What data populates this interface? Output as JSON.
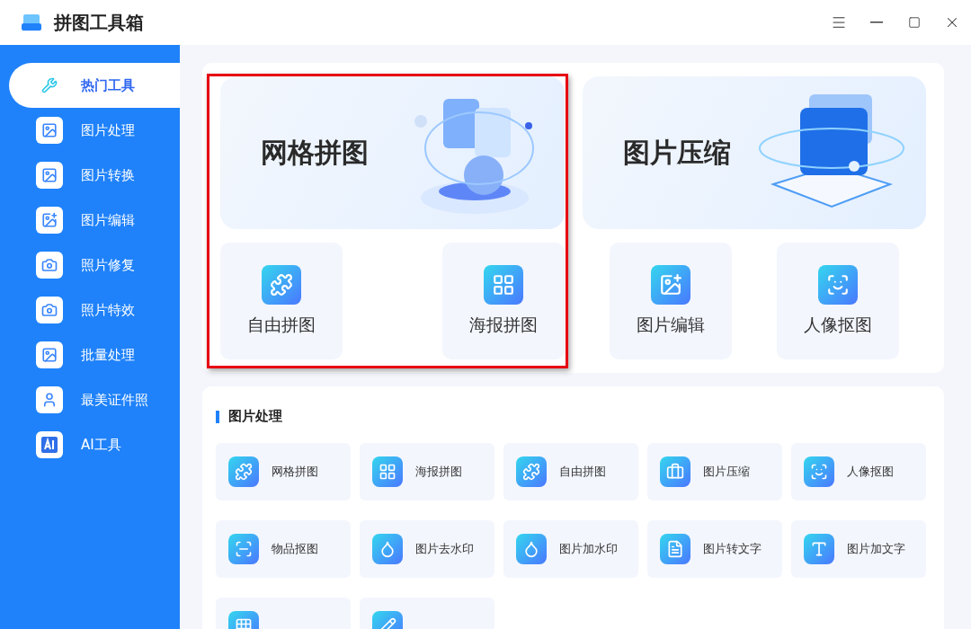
{
  "window": {
    "title": "拼图工具箱"
  },
  "sidebar": {
    "items": [
      {
        "label": "热门工具",
        "selected": true
      },
      {
        "label": "图片处理",
        "selected": false
      },
      {
        "label": "图片转换",
        "selected": false
      },
      {
        "label": "图片编辑",
        "selected": false
      },
      {
        "label": "照片修复",
        "selected": false
      },
      {
        "label": "照片特效",
        "selected": false
      },
      {
        "label": "批量处理",
        "selected": false
      },
      {
        "label": "最美证件照",
        "selected": false
      },
      {
        "label": "AI工具",
        "selected": false
      }
    ]
  },
  "featured": [
    {
      "title": "网格拼图",
      "highlighted": true,
      "tools": [
        "自由拼图",
        "海报拼图"
      ]
    },
    {
      "title": "图片压缩",
      "highlighted": false,
      "tools": [
        "图片编辑",
        "人像抠图"
      ]
    }
  ],
  "section": {
    "title": "图片处理",
    "tools": [
      {
        "kind": "labeled",
        "label": "网格拼图"
      },
      {
        "kind": "labeled",
        "label": "海报拼图"
      },
      {
        "kind": "labeled",
        "label": "自由拼图"
      },
      {
        "kind": "labeled",
        "label": "图片压缩"
      },
      {
        "kind": "labeled",
        "label": "人像抠图"
      },
      {
        "kind": "labeled",
        "label": "物品抠图"
      },
      {
        "kind": "labeled",
        "label": "图片去水印"
      },
      {
        "kind": "labeled",
        "label": "图片加水印"
      },
      {
        "kind": "labeled",
        "label": "图片转文字"
      },
      {
        "kind": "labeled",
        "label": "图片加文字"
      },
      {
        "kind": "cut"
      },
      {
        "kind": "cut"
      }
    ]
  }
}
